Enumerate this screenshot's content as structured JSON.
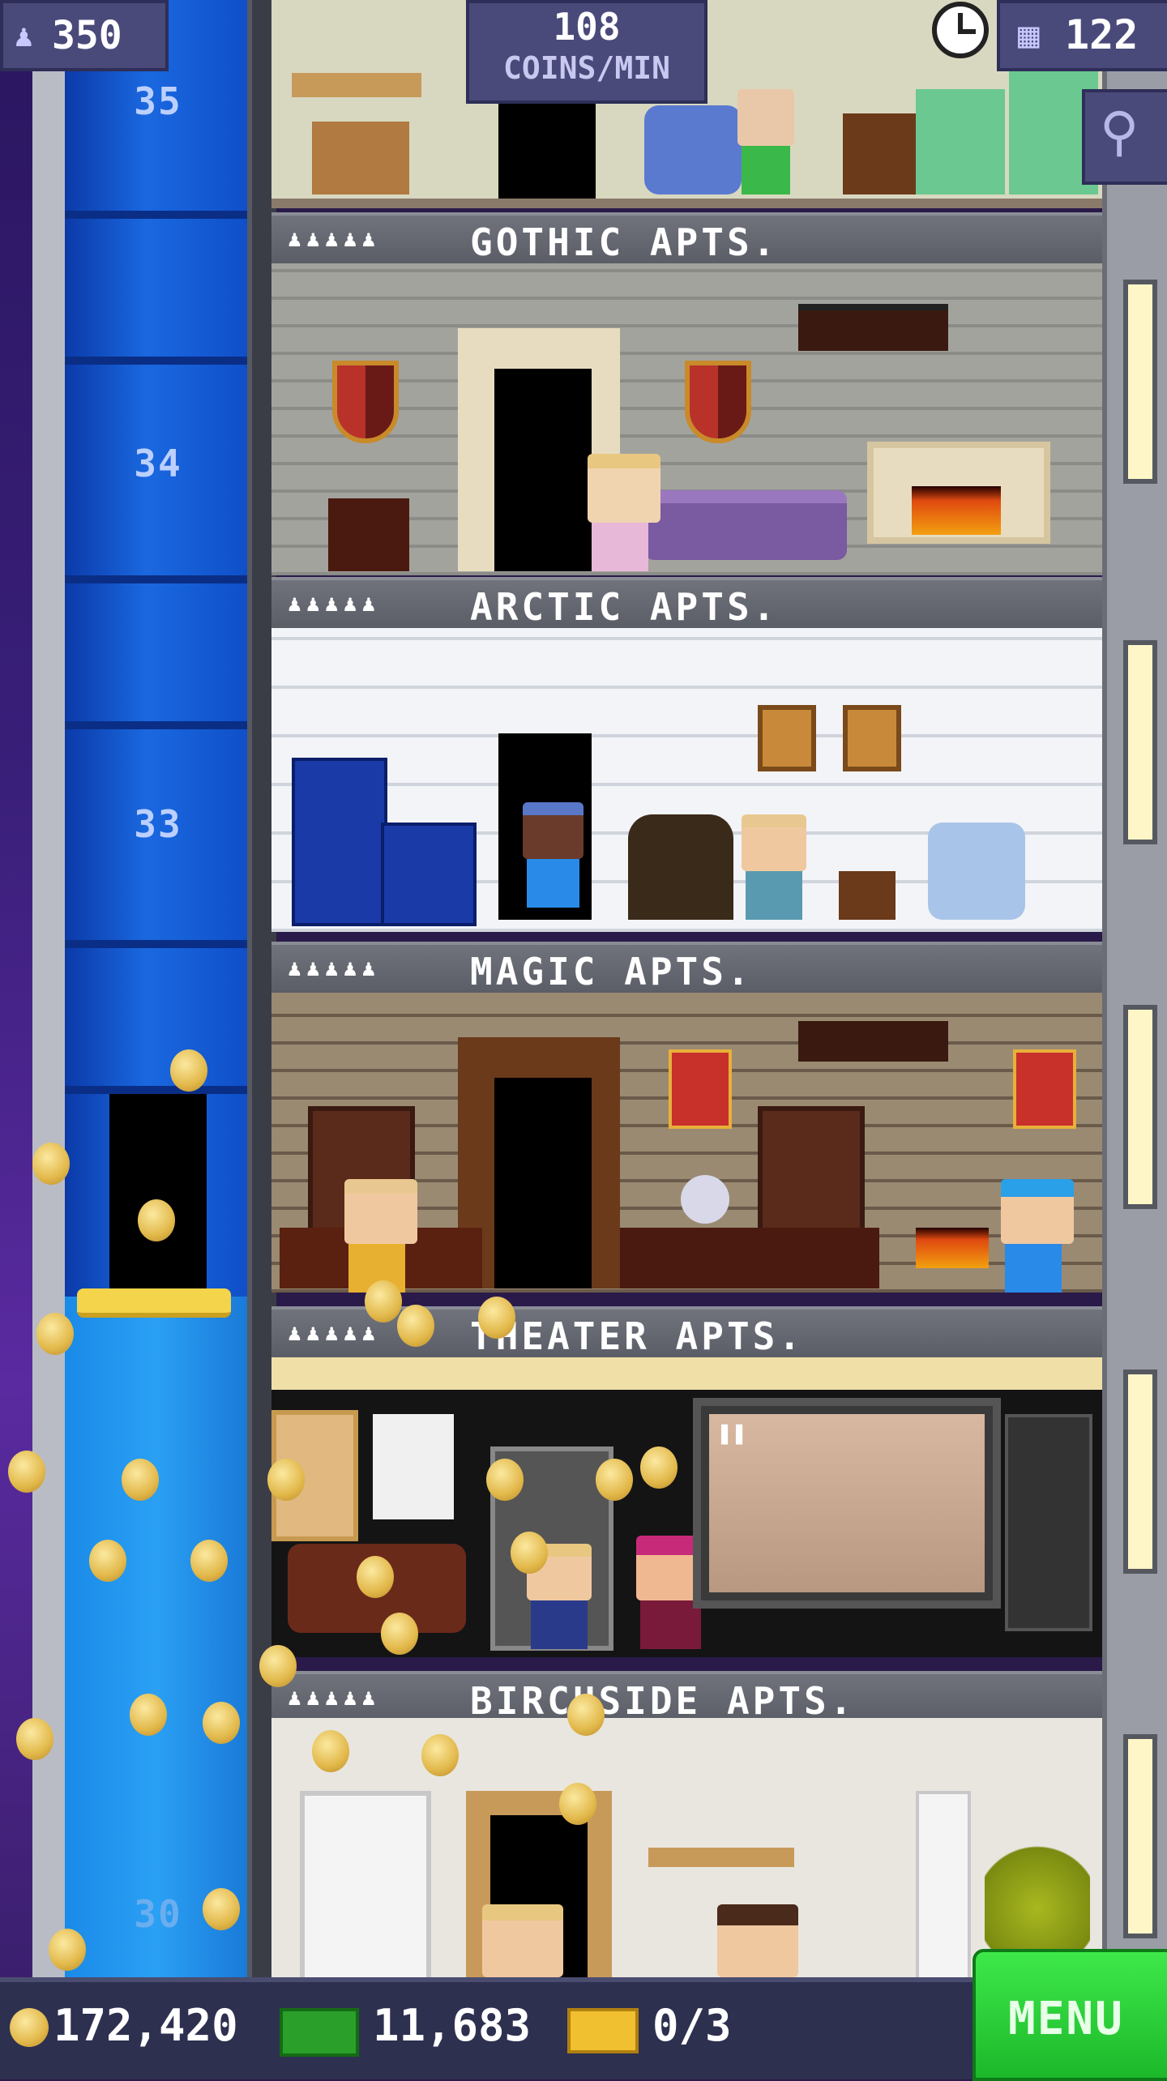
{
  "hud": {
    "population": "350",
    "population_icon": "person-icon",
    "coin_rate_value": "108",
    "coin_rate_unit": "COINS/MIN",
    "clock_icon": "clock-icon",
    "floors_count": "122",
    "floors_icon": "building-icon",
    "search_icon": "magnifier-icon"
  },
  "elevator": {
    "floor_labels": [
      "35",
      "34",
      "33",
      "30"
    ]
  },
  "floors": [
    {
      "name": "GOTHIC APTS.",
      "residents": "♟♟♟♟♟"
    },
    {
      "name": "ARCTIC APTS.",
      "residents": "♟♟♟♟♟"
    },
    {
      "name": "MAGIC APTS.",
      "residents": "♟♟♟♟♟"
    },
    {
      "name": "THEATER APTS.",
      "residents": "♟♟♟♟♟"
    },
    {
      "name": "BIRCHSIDE APTS.",
      "residents": "♟♟♟♟♟"
    }
  ],
  "bottom_bar": {
    "coins": "172,420",
    "tower_bux": "11,683",
    "tickets": "0/3",
    "menu_label": "MENU"
  },
  "colors": {
    "elevator_blue": "#1a68e0",
    "menu_green": "#2ad23a",
    "hud_panel": "#4a4a7a",
    "coin_gold": "#e2b84a"
  }
}
